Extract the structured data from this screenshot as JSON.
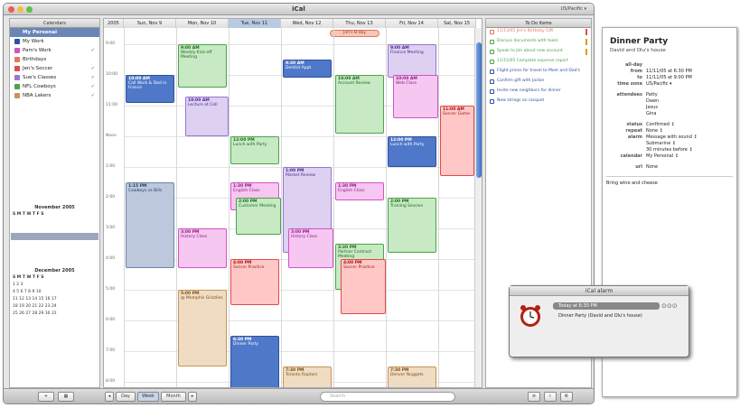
{
  "window": {
    "title": "iCal",
    "timezone": "US/Pacific ▾"
  },
  "sidebar": {
    "header": "Calendars",
    "items": [
      {
        "label": "My Personal",
        "color": "#6a85b8",
        "checked": "",
        "selected": true
      },
      {
        "label": "My Work",
        "color": "#2e50a0",
        "checked": ""
      },
      {
        "label": "Pam's Work",
        "color": "#d153c4",
        "checked": "✓"
      },
      {
        "label": "Birthdays",
        "color": "#e2775a",
        "checked": ""
      },
      {
        "label": "Jen's Soccer",
        "color": "#e04b48",
        "checked": "✓"
      },
      {
        "label": "Sue's Classes",
        "color": "#9a74d0",
        "checked": "✓"
      },
      {
        "label": "NFL Cowboys",
        "color": "#4aa548",
        "checked": "✓"
      },
      {
        "label": "NBA Lakers",
        "color": "#c49559",
        "checked": "✓"
      }
    ]
  },
  "mini_nov": {
    "title": "November 2005",
    "days": "S M T W T F S",
    "rows": [
      "",
      "",
      "",
      "",
      "",
      "",
      ""
    ]
  },
  "mini_dec": {
    "title": "December 2005",
    "days": "S M T W T F S",
    "rows": [
      "1 2 3",
      "4 5 6 7 8 9 10",
      "11 12 13 14 15 16 17",
      "18 19 20 21 22 23 24",
      "25 26 27 28 29 30 31"
    ]
  },
  "days": [
    "2005",
    "Sun, Nov 9",
    "Mon, Nov 10",
    "Tue, Nov 11",
    "Wed, Nov 12",
    "Thu, Nov 13",
    "Fri, Nov 14",
    "Sat, Nov 15"
  ],
  "hours": [
    "9:00",
    "10:00",
    "11:00",
    "Noon",
    "1:00",
    "2:00",
    "3:00",
    "4:00",
    "5:00",
    "6:00",
    "7:00",
    "8:00"
  ],
  "allday_event": "Jim's B-day",
  "events": [
    {
      "time": "9:00 AM",
      "title": "Weekly Kick-off Meeting"
    },
    {
      "time": "10:00 AM",
      "title": "Call Work & Dad in France"
    },
    {
      "time": "10:00 AM",
      "title": "Lecture at Cell"
    },
    {
      "time": "9:30 AM",
      "title": "Dentist Appt."
    },
    {
      "time": "10:00 AM",
      "title": "Account Review"
    },
    {
      "time": "9:00 AM",
      "title": "Finance Meeting"
    },
    {
      "time": "10:00 AM",
      "title": "Web Class"
    },
    {
      "time": "11:00 AM",
      "title": "Soccer Game"
    },
    {
      "time": "12:00 PM",
      "title": "Lunch with Party"
    },
    {
      "time": "12:00 PM",
      "title": "Lunch with Party"
    },
    {
      "time": "1:15 PM",
      "title": "Cowboys vs Bills"
    },
    {
      "time": "1:00 PM",
      "title": "Market Review"
    },
    {
      "time": "1:30 PM",
      "title": "English Class"
    },
    {
      "time": "1:30 PM",
      "title": "English Class"
    },
    {
      "time": "2:00 PM",
      "title": "Customer Meeting"
    },
    {
      "time": "2:00 PM",
      "title": "Training Session"
    },
    {
      "time": "3:00 PM",
      "title": "History Class"
    },
    {
      "time": "3:00 PM",
      "title": "History Class"
    },
    {
      "time": "4:00 PM",
      "title": "Soccer Practice"
    },
    {
      "time": "3:30 PM",
      "title": "Partner Contract Meeting"
    },
    {
      "time": "4:00 PM",
      "title": "Soccer Practice"
    },
    {
      "time": "5:00 PM",
      "title": "@ Memphis Grizzlies"
    },
    {
      "time": "6:30 PM",
      "title": "Dinner Party"
    },
    {
      "time": "7:30 PM",
      "title": "Toronto Raptors"
    },
    {
      "time": "7:30 PM",
      "title": "Denver Nuggets"
    }
  ],
  "todo": {
    "header": "To Do Items",
    "items": [
      {
        "text": "11/13/05 Jim's Birthday Gift",
        "color": "#e2775a",
        "pri": "#e04b48"
      },
      {
        "text": "Discuss documents with team",
        "color": "#4aa548",
        "pri": "#d9a000"
      },
      {
        "text": "Speak to Jim about new account",
        "color": "#4aa548",
        "pri": "#d9a000"
      },
      {
        "text": "11/15/05 Complete expense report",
        "color": "#4aa548",
        "pri": ""
      },
      {
        "text": "Flight prices for travel to Mom and Dad's",
        "color": "#2e50a0",
        "pri": ""
      },
      {
        "text": "Confirm gift with Jackie",
        "color": "#2e50a0",
        "pri": ""
      },
      {
        "text": "Invite new neighbors for dinner",
        "color": "#2e50a0",
        "pri": ""
      },
      {
        "text": "New strings on racquet",
        "color": "#2e50a0",
        "pri": ""
      }
    ]
  },
  "bottom": {
    "day": "Day",
    "week": "Week",
    "month": "Month",
    "search_placeholder": "Search"
  },
  "info": {
    "title": "Dinner Party",
    "subtitle": "David and Olu's house",
    "rows": [
      {
        "label": "all-day",
        "value": ""
      },
      {
        "label": "from",
        "value": "11/11/05 at 6:30 PM"
      },
      {
        "label": "to",
        "value": "11/11/05 at 9:00 PM"
      },
      {
        "label": "time zone",
        "value": "US/Pacific ▾"
      },
      {
        "label": "attendees",
        "value": "Patty"
      },
      {
        "label": "",
        "value": "Dawn"
      },
      {
        "label": "",
        "value": "Jesus"
      },
      {
        "label": "",
        "value": "Gina"
      },
      {
        "label": "status",
        "value": "Confirmed ↕"
      },
      {
        "label": "repeat",
        "value": "None ↕"
      },
      {
        "label": "alarm",
        "value": "Message with sound ↕"
      },
      {
        "label": "",
        "value": "Submarine ↕"
      },
      {
        "label": "",
        "value": "30 minutes before ↕"
      },
      {
        "label": "calendar",
        "value": "My Personal ↕"
      },
      {
        "label": "url",
        "value": "None"
      }
    ],
    "note": "Bring wine and cheese"
  },
  "alarm": {
    "window_title": "iCal alarm",
    "header": "Today at 6:30 PM",
    "message": "Dinner Party (David and Olu's house)"
  }
}
